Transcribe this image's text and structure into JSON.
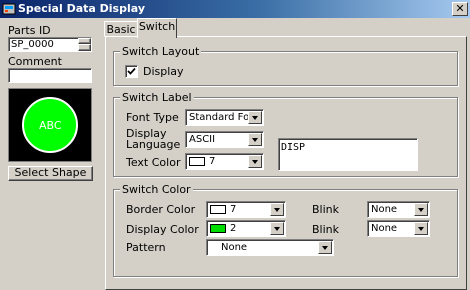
{
  "window": {
    "title": "Special Data Display",
    "close_glyph": "✕"
  },
  "left_panel": {
    "parts_id_label": "Parts ID",
    "parts_id_value": "SP_0000",
    "comment_label": "Comment",
    "comment_value": "",
    "preview_text": "ABC",
    "preview_color": "#00ff00",
    "select_shape_label": "Select Shape"
  },
  "tabs": [
    {
      "label": "Basic",
      "active": false
    },
    {
      "label": "Switch",
      "active": true
    }
  ],
  "switch_layout": {
    "title": "Switch Layout",
    "display_label": "Display",
    "display_checked": true
  },
  "switch_label": {
    "title": "Switch Label",
    "font_type_label": "Font Type",
    "font_type_value": "Standard Font",
    "display_language_label_1": "Display",
    "display_language_label_2": "Language",
    "display_language_value": "ASCII",
    "text_color_label": "Text Color",
    "text_color_value": "7",
    "text_color_swatch": "#ffffff",
    "label_text": "DISP"
  },
  "switch_color": {
    "title": "Switch Color",
    "border_color_label": "Border Color",
    "border_color_value": "7",
    "border_color_swatch": "#ffffff",
    "display_color_label": "Display Color",
    "display_color_value": "2",
    "display_color_swatch": "#00dd00",
    "blink_label_1": "Blink",
    "blink_value_1": "None",
    "blink_label_2": "Blink",
    "blink_value_2": "None",
    "pattern_label": "Pattern",
    "pattern_value": "None"
  }
}
